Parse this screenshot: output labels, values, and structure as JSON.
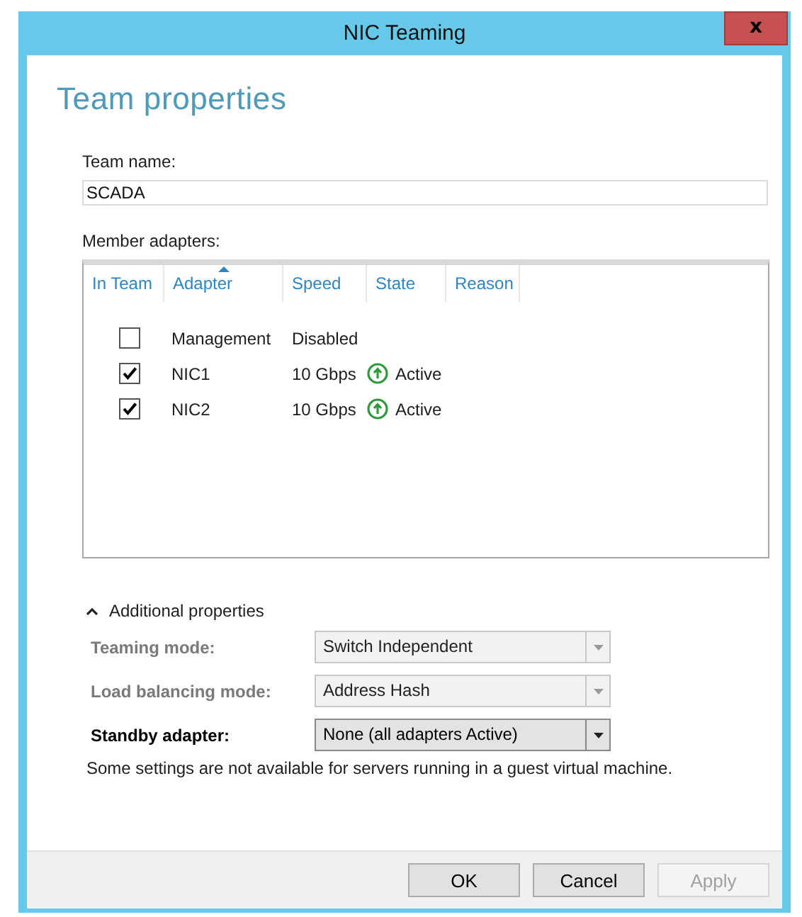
{
  "window": {
    "title": "NIC Teaming",
    "close": "x"
  },
  "heading": "Team properties",
  "team_name": {
    "label": "Team name:",
    "value": "SCADA"
  },
  "member_adapters": {
    "label": "Member adapters:",
    "columns": [
      {
        "label": "In Team",
        "sorted": false
      },
      {
        "label": "Adapter",
        "sorted": true
      },
      {
        "label": "Speed",
        "sorted": false
      },
      {
        "label": "State",
        "sorted": false
      },
      {
        "label": "Reason",
        "sorted": false
      }
    ],
    "rows": [
      {
        "kind": "plain",
        "in_team": false,
        "adapter": "Management",
        "speed": "Disabled"
      },
      {
        "kind": "up",
        "in_team": true,
        "adapter": "NIC1",
        "speed": "10 Gbps",
        "state": "Active"
      },
      {
        "kind": "up",
        "in_team": true,
        "adapter": "NIC2",
        "speed": "10 Gbps",
        "state": "Active"
      }
    ]
  },
  "additional": {
    "label": "Additional properties",
    "expanded": true,
    "fields": [
      {
        "label": "Teaming mode:",
        "value": "Switch Independent",
        "disabled": true
      },
      {
        "label": "Load balancing mode:",
        "value": "Address Hash",
        "disabled": true
      },
      {
        "label": "Standby adapter:",
        "value": "None (all adapters Active)",
        "disabled": false
      }
    ],
    "note": "Some settings are not available for servers running in a guest virtual machine."
  },
  "buttons": [
    {
      "label": "OK",
      "disabled": false
    },
    {
      "label": "Cancel",
      "disabled": false
    },
    {
      "label": "Apply",
      "disabled": true
    }
  ]
}
